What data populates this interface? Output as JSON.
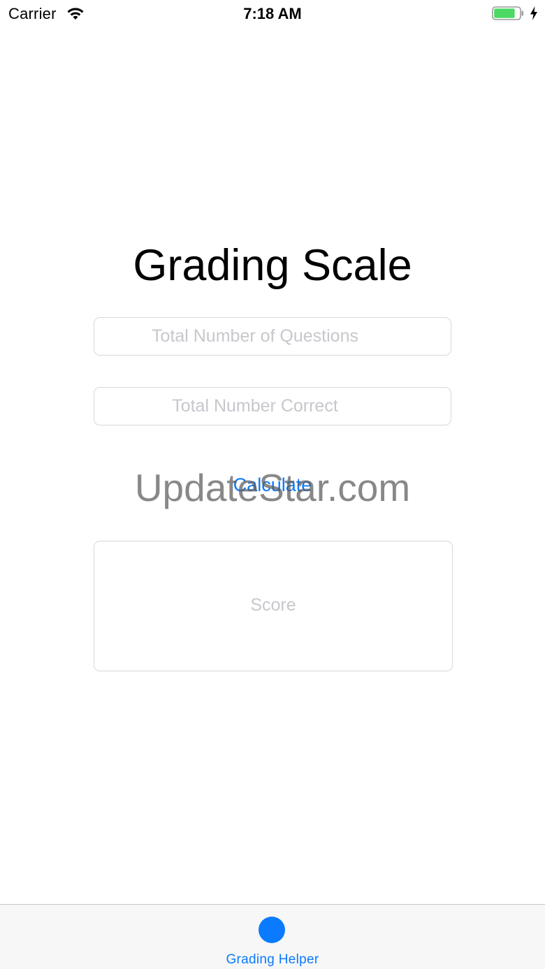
{
  "status_bar": {
    "carrier": "Carrier",
    "time": "7:18 AM",
    "battery_level": 0.85,
    "charging": true
  },
  "main": {
    "title": "Grading Scale",
    "questions_field": {
      "placeholder": "Total Number of Questions",
      "value": ""
    },
    "correct_field": {
      "placeholder": "Total Number Correct",
      "value": ""
    },
    "calculate_label": "Calculate",
    "score_placeholder": "Score"
  },
  "watermark": "UpdateStar.com",
  "tab_bar": {
    "items": [
      {
        "label": "Grading Helper",
        "icon": "circle-icon",
        "selected": true
      }
    ]
  },
  "colors": {
    "accent": "#0a7aff",
    "placeholder": "#c7c7cd",
    "battery_fill": "#4cd964"
  }
}
